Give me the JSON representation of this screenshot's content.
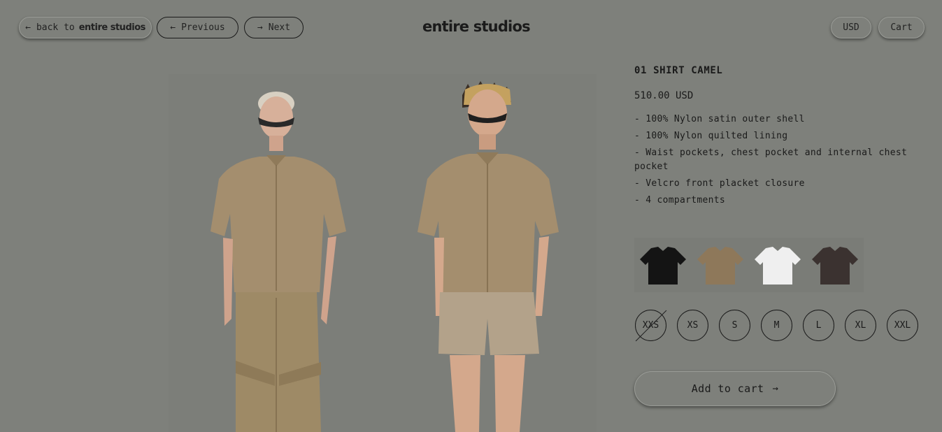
{
  "nav": {
    "back_label": "back to",
    "back_brand": "entire studios",
    "previous_label": "Previous",
    "next_label": "Next",
    "arrow_left": "←",
    "arrow_right": "→"
  },
  "brand": {
    "logo": "entire studios"
  },
  "header_right": {
    "currency_label": "USD",
    "cart_label": "Cart"
  },
  "product": {
    "title": "01 SHIRT CAMEL",
    "price": "510.00 USD",
    "description": [
      "- 100% Nylon satin outer shell",
      "- 100% Nylon quilted lining",
      "- Waist pockets, chest pocket and internal chest pocket",
      "- Velcro front placket closure",
      "- 4 compartments"
    ],
    "colors": [
      {
        "name": "black-shirt",
        "hex": "#141414"
      },
      {
        "name": "camel-shirt",
        "hex": "#8e785a"
      },
      {
        "name": "white-shirt",
        "hex": "#efefef"
      },
      {
        "name": "brown-shirt",
        "hex": "#3b3230"
      }
    ],
    "sizes": [
      "XXS",
      "XS",
      "S",
      "M",
      "L",
      "XL",
      "XXL"
    ],
    "sold_out_size": "XXS",
    "add_to_cart_label": "Add to cart",
    "add_to_cart_arrow": "→"
  },
  "colors": {
    "page_background": "#7e807b",
    "shirt_camel": "#a48e6e",
    "shorts_khaki": "#b3a28a",
    "pants_camel": "#9e8a66"
  }
}
